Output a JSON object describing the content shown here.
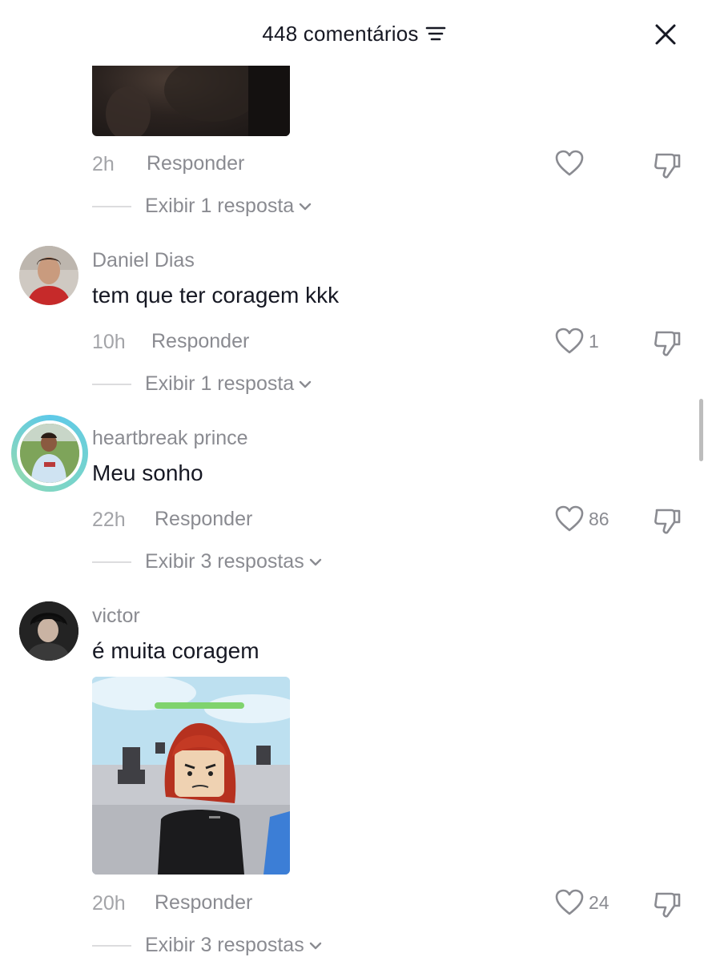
{
  "header": {
    "title": "448 comentários",
    "filter_icon": "filter-icon",
    "close_icon": "close-icon"
  },
  "colors": {
    "text": "#161823",
    "muted": "#8a8b91",
    "time": "#a3a4a8"
  },
  "comments": [
    {
      "time": "2h",
      "reply_label": "Responder",
      "likes": "",
      "view_replies": "Exibir 1 resposta"
    },
    {
      "username": "Daniel Dias",
      "text": "tem que ter coragem kkk",
      "time": "10h",
      "reply_label": "Responder",
      "likes": "1",
      "view_replies": "Exibir 1 resposta"
    },
    {
      "username": "heartbreak prince",
      "text": "Meu sonho",
      "time": "22h",
      "reply_label": "Responder",
      "likes": "86",
      "view_replies": "Exibir 3 respostas"
    },
    {
      "username": "victor",
      "text": "é muita coragem",
      "time": "20h",
      "reply_label": "Responder",
      "likes": "24",
      "view_replies": "Exibir 3 respostas"
    }
  ]
}
